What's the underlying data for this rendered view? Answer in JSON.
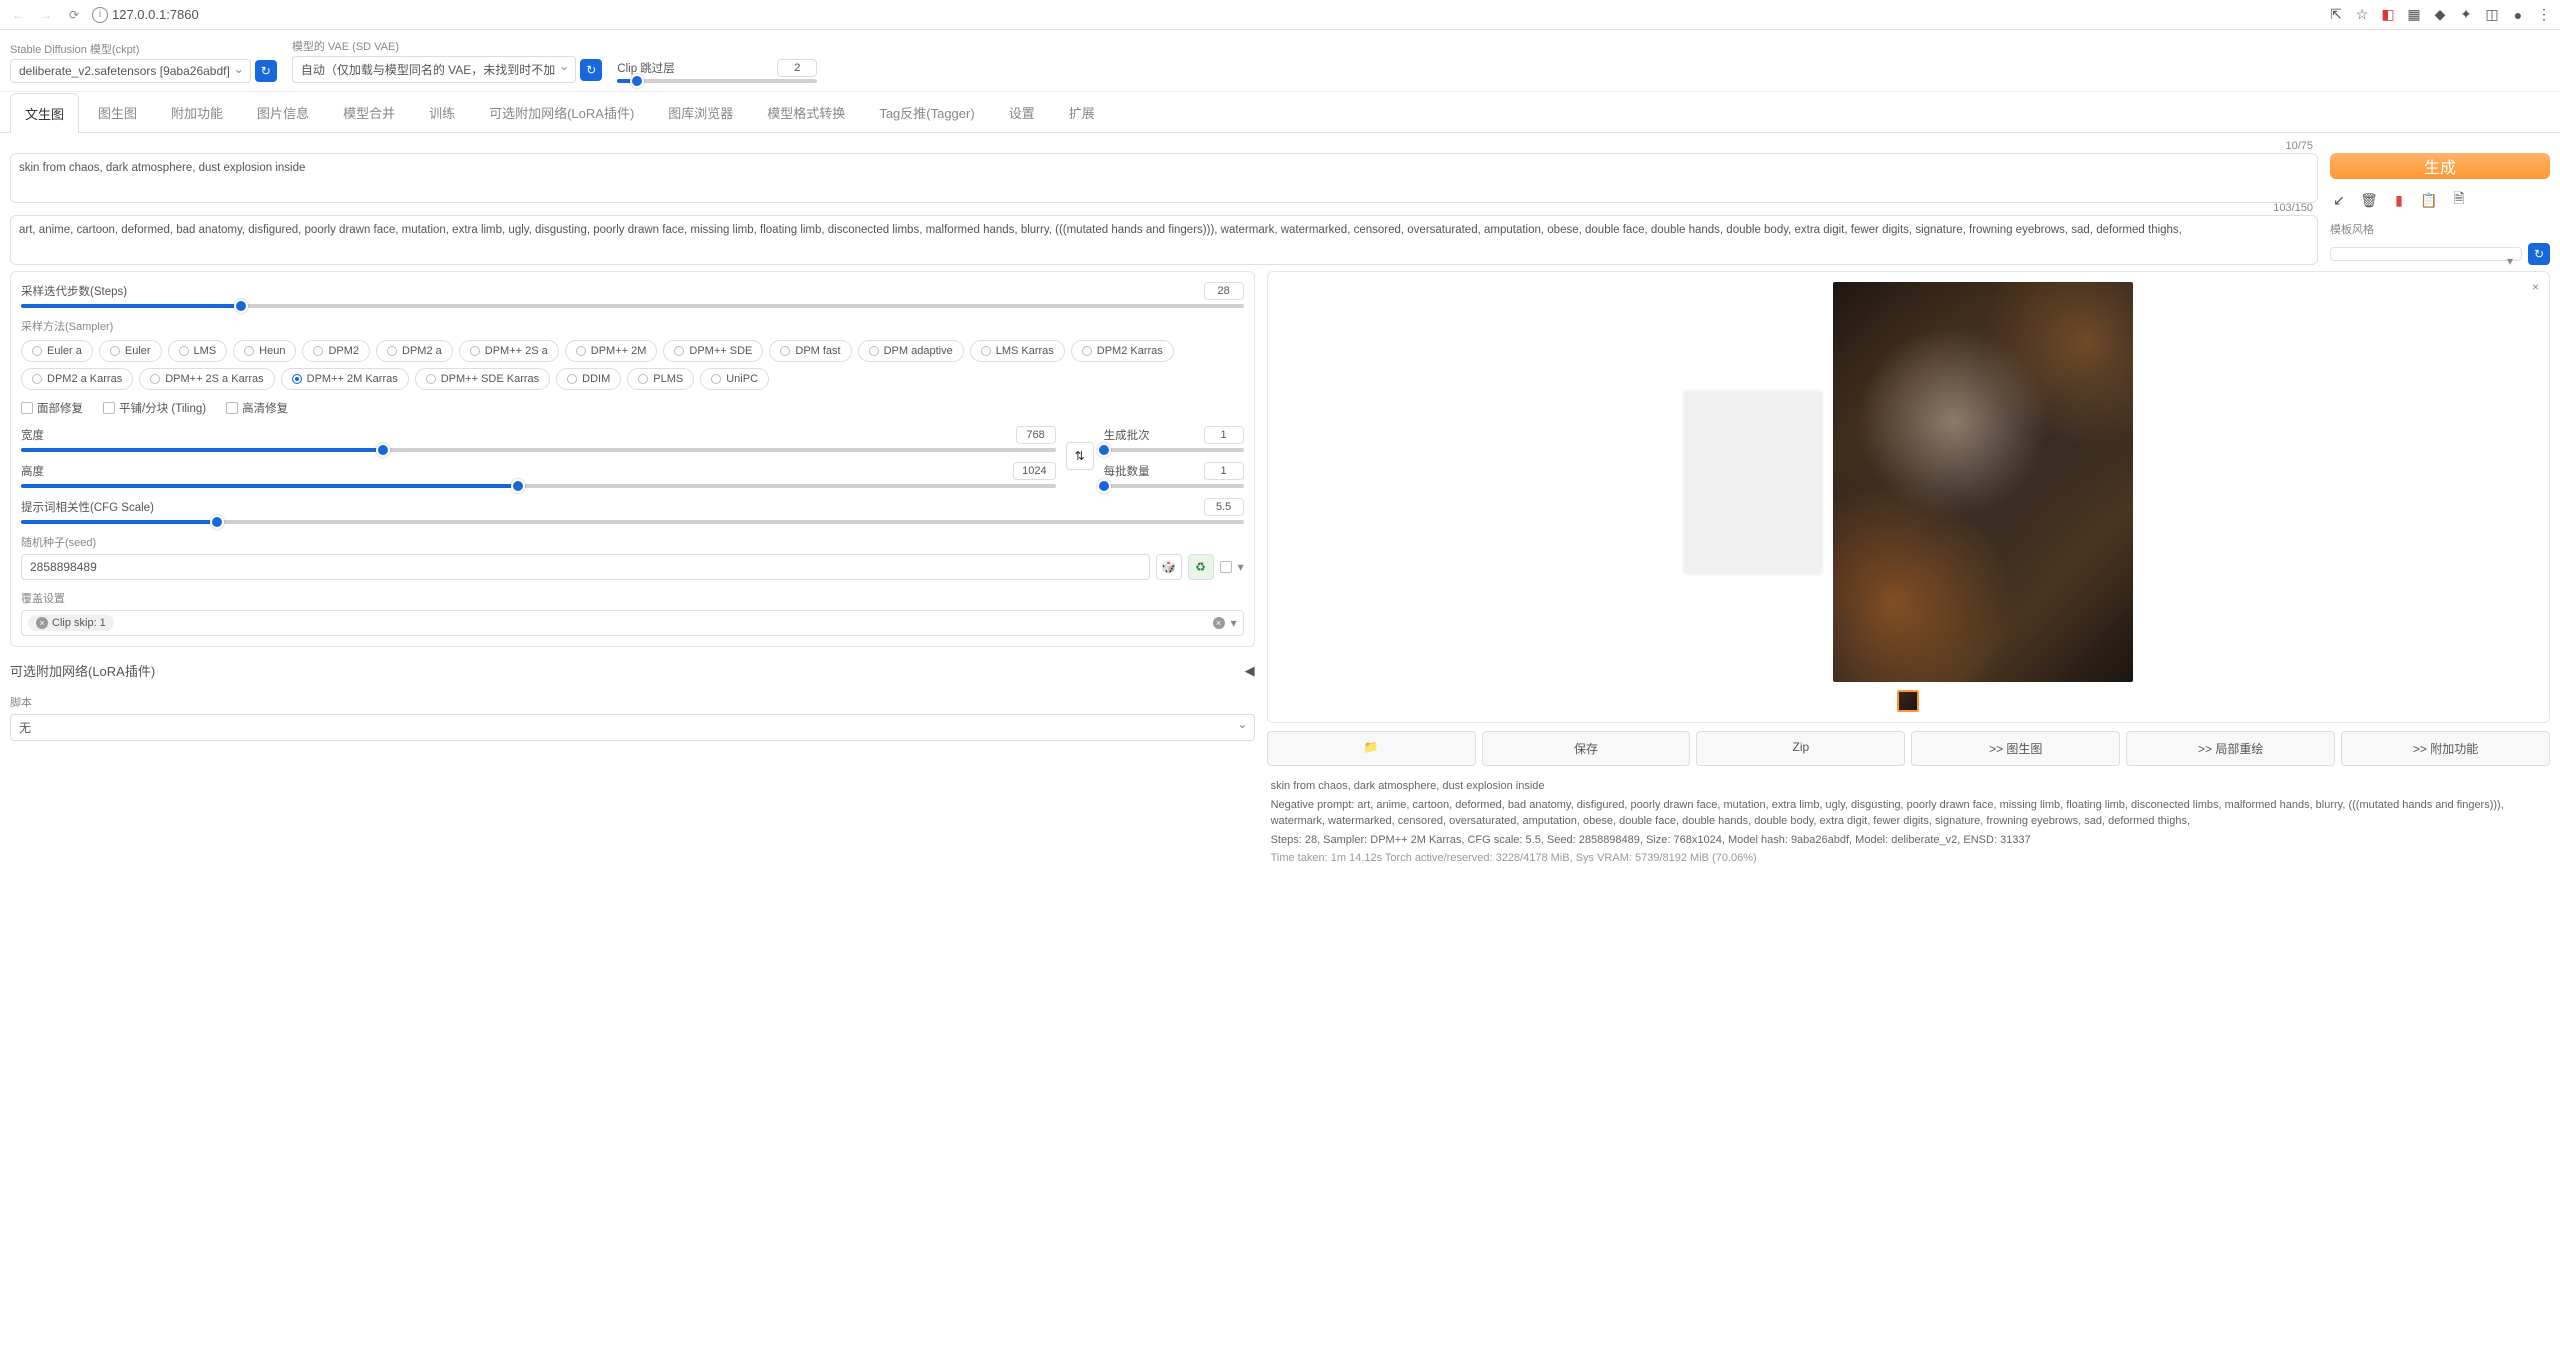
{
  "browser": {
    "url": "127.0.0.1:7860"
  },
  "model": {
    "ckpt_label": "Stable Diffusion 模型(ckpt)",
    "ckpt_value": "deliberate_v2.safetensors [9aba26abdf]",
    "vae_label": "模型的 VAE (SD VAE)",
    "vae_value": "自动（仅加载与模型同名的 VAE，未找到时不加",
    "clip_label": "Clip 跳过层",
    "clip_value": "2"
  },
  "tabs": [
    "文生图",
    "图生图",
    "附加功能",
    "图片信息",
    "模型合并",
    "训练",
    "可选附加网络(LoRA插件)",
    "图库浏览器",
    "模型格式转换",
    "Tag反推(Tagger)",
    "设置",
    "扩展"
  ],
  "prompt": {
    "positive": "skin from chaos, dark atmosphere, dust explosion inside",
    "pos_counter": "10/75",
    "negative": "art, anime, cartoon, deformed, bad anatomy, disfigured, poorly drawn face, mutation, extra limb, ugly, disgusting, poorly drawn face, missing limb, floating limb, disconected limbs, malformed hands, blurry, (((mutated hands and fingers))), watermark, watermarked, censored, oversaturated, amputation, obese, double face, double hands, double body, extra digit, fewer digits, signature, frowning eyebrows, sad, deformed thighs,",
    "neg_counter": "103/150"
  },
  "right_panel": {
    "generate": "生成",
    "style_label": "模板风格"
  },
  "params": {
    "steps_label": "采样迭代步数(Steps)",
    "steps_value": "28",
    "sampler_label": "采样方法(Sampler)",
    "samplers": [
      "Euler a",
      "Euler",
      "LMS",
      "Heun",
      "DPM2",
      "DPM2 a",
      "DPM++ 2S a",
      "DPM++ 2M",
      "DPM++ SDE",
      "DPM fast",
      "DPM adaptive",
      "LMS Karras",
      "DPM2 Karras",
      "DPM2 a Karras",
      "DPM++ 2S a Karras",
      "DPM++ 2M Karras",
      "DPM++ SDE Karras",
      "DDIM",
      "PLMS",
      "UniPC"
    ],
    "sampler_selected": "DPM++ 2M Karras",
    "face_fix": "面部修复",
    "tiling": "平铺/分块 (Tiling)",
    "hires": "高清修复",
    "width_label": "宽度",
    "width_value": "768",
    "height_label": "高度",
    "height_value": "1024",
    "batch_count_label": "生成批次",
    "batch_count_value": "1",
    "batch_size_label": "每批数量",
    "batch_size_value": "1",
    "cfg_label": "提示词相关性(CFG Scale)",
    "cfg_value": "5.5",
    "seed_label": "随机种子(seed)",
    "seed_value": "2858898489",
    "override_label": "覆盖设置",
    "clip_tag": "Clip skip: 1",
    "lora_label": "可选附加网络(LoRA插件)",
    "script_label": "脚本",
    "script_value": "无"
  },
  "output": {
    "buttons": [
      "📁",
      "保存",
      "Zip",
      ">> 图生图",
      ">> 局部重绘",
      ">> 附加功能"
    ],
    "meta_prompt": "skin from chaos, dark atmosphere, dust explosion inside",
    "meta_negative": "Negative prompt: art, anime, cartoon, deformed, bad anatomy, disfigured, poorly drawn face, mutation, extra limb, ugly, disgusting, poorly drawn face, missing limb, floating limb, disconected limbs, malformed hands, blurry, (((mutated hands and fingers))), watermark, watermarked, censored, oversaturated, amputation, obese, double face, double hands, double body, extra digit, fewer digits, signature, frowning eyebrows, sad, deformed thighs,",
    "meta_params": "Steps: 28, Sampler: DPM++ 2M Karras, CFG scale: 5.5, Seed: 2858898489, Size: 768x1024, Model hash: 9aba26abdf, Model: deliberate_v2, ENSD: 31337",
    "meta_time": "Time taken: 1m 14.12s   Torch active/reserved: 3228/4178 MiB, Sys VRAM: 5739/8192 MiB (70.06%)"
  }
}
